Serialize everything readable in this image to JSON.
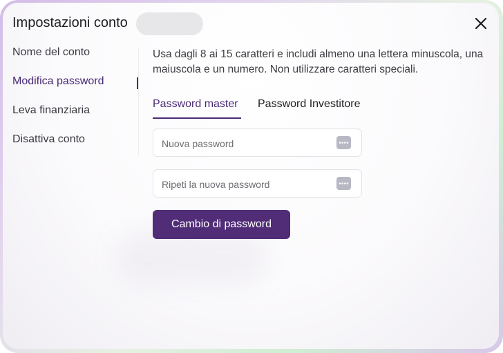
{
  "header": {
    "title": "Impostazioni conto"
  },
  "sidebar": {
    "items": [
      {
        "label": "Nome del conto"
      },
      {
        "label": "Modifica password"
      },
      {
        "label": "Leva finanziaria"
      },
      {
        "label": "Disattiva conto"
      }
    ],
    "active_index": 1
  },
  "main": {
    "hint": "Usa dagli 8 ai 15 caratteri e includi almeno una lettera minuscola, una maiuscola e un numero. Non utilizzare caratteri speciali.",
    "tabs": [
      {
        "label": "Password master"
      },
      {
        "label": "Password Investitore"
      }
    ],
    "active_tab": 0,
    "fields": {
      "new_password": {
        "placeholder": "Nuova password",
        "value": ""
      },
      "repeat_password": {
        "placeholder": "Ripeti la nuova password",
        "value": ""
      }
    },
    "submit_label": "Cambio di password"
  },
  "icons": {
    "close": "close-icon",
    "password_toggle": "password-dots-icon"
  },
  "colors": {
    "accent": "#512d78",
    "accent_text": "#4a2a74",
    "icon_bg": "#b7b8c3"
  }
}
